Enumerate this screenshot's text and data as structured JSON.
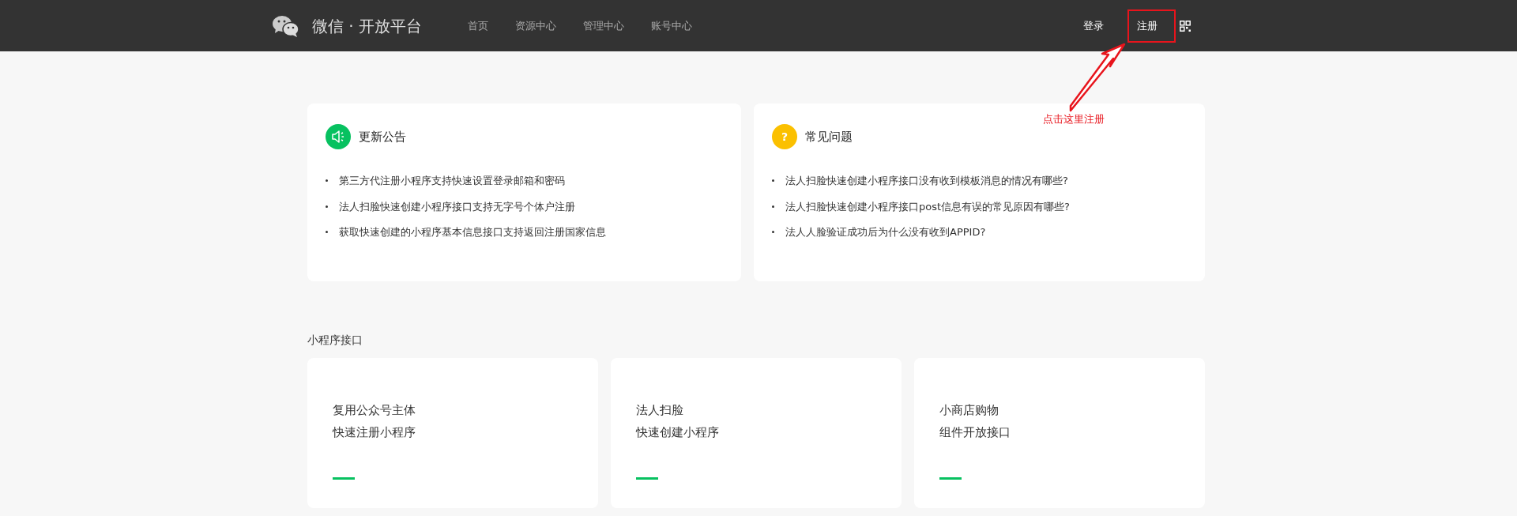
{
  "header": {
    "logo_title": "微信 · 开放平台",
    "nav": [
      {
        "label": "首页"
      },
      {
        "label": "资源中心"
      },
      {
        "label": "管理中心"
      },
      {
        "label": "账号中心"
      }
    ],
    "login": "登录",
    "register": "注册"
  },
  "annotation": {
    "text": "点击这里注册"
  },
  "panels": [
    {
      "kind": "notice",
      "title": "更新公告",
      "items": [
        "第三方代注册小程序支持快速设置登录邮箱和密码",
        "法人扫脸快速创建小程序接口支持无字号个体户注册",
        "获取快速创建的小程序基本信息接口支持返回注册国家信息"
      ]
    },
    {
      "kind": "faq",
      "title": "常见问题",
      "icon_text": "?",
      "items": [
        "法人扫脸快速创建小程序接口没有收到模板消息的情况有哪些?",
        "法人扫脸快速创建小程序接口post信息有误的常见原因有哪些?",
        "法人人脸验证成功后为什么没有收到APPID?"
      ]
    }
  ],
  "section": {
    "title": "小程序接口",
    "cards": [
      {
        "lines": [
          "复用公众号主体",
          "快速注册小程序"
        ]
      },
      {
        "lines": [
          "法人扫脸",
          "快速创建小程序"
        ]
      },
      {
        "lines": [
          "小商店购物",
          "组件开放接口"
        ]
      }
    ]
  }
}
